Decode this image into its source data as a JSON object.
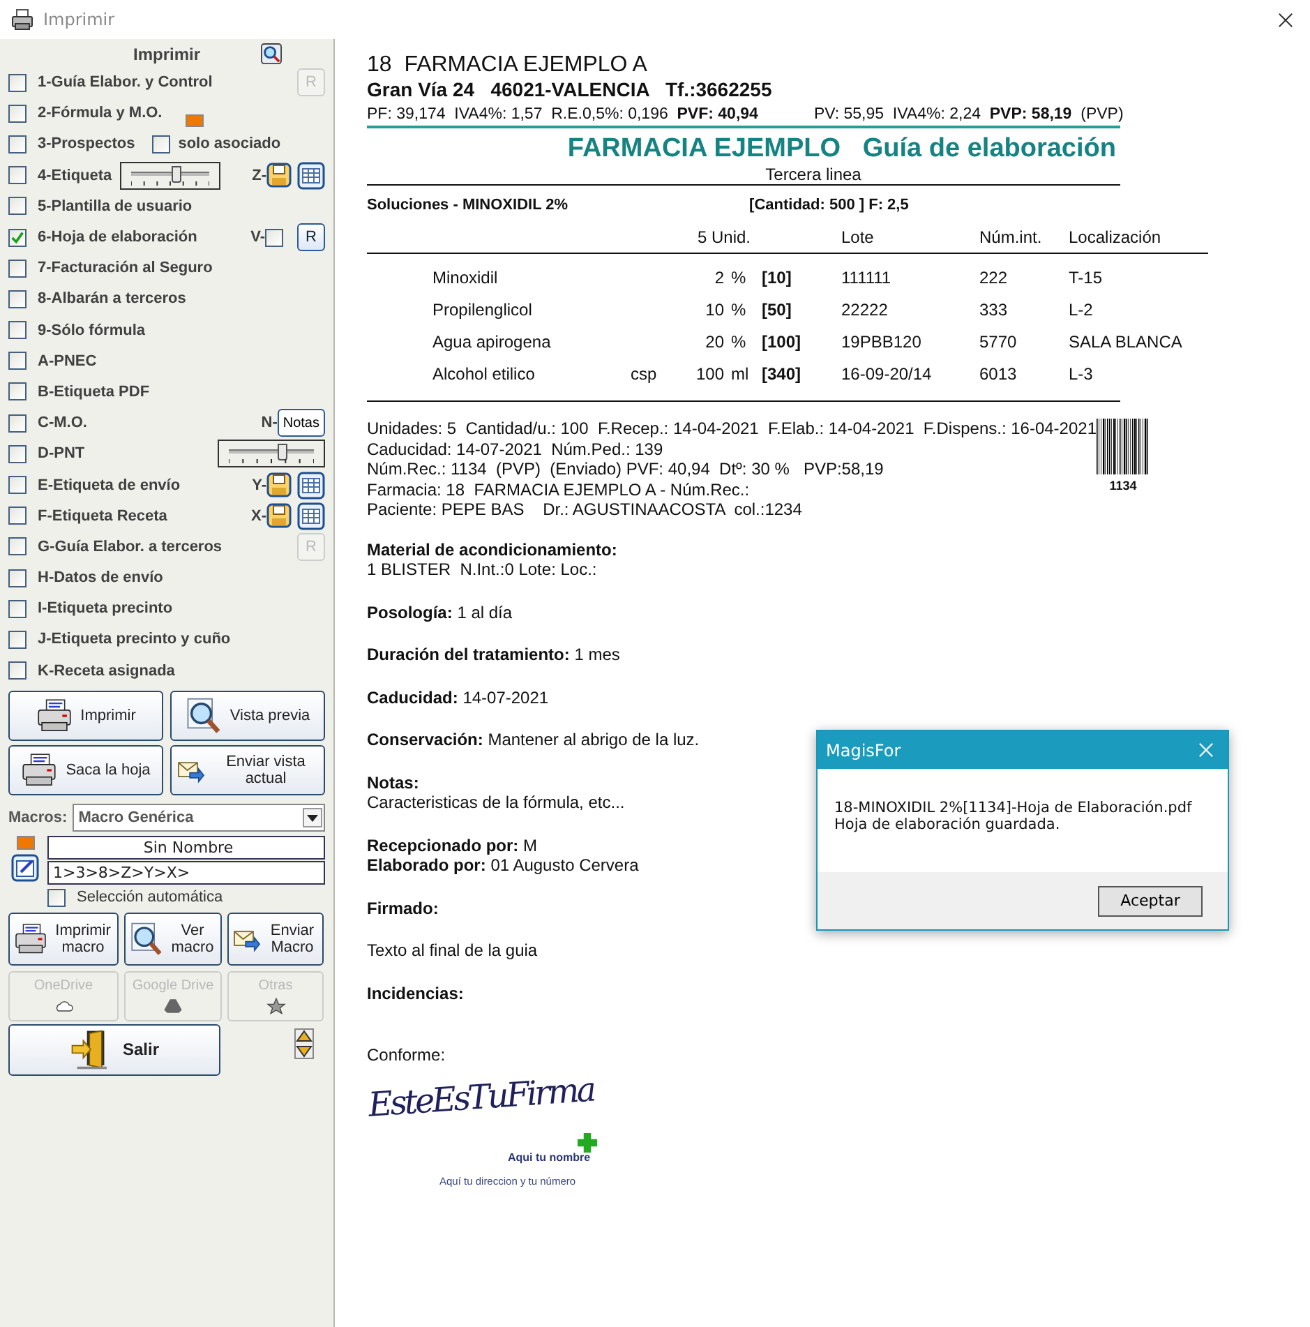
{
  "window": {
    "title": "Imprimir"
  },
  "print_panel": {
    "title": "Imprimir",
    "options": [
      {
        "label": "1-Guía Elabor. y Control",
        "checked": false,
        "kind": "r_button",
        "button": "R",
        "button_disabled": true
      },
      {
        "label": "2-Fórmula y M.O.",
        "checked": false,
        "kind": "marker"
      },
      {
        "label": "3-Prospectos",
        "checked": false,
        "kind": "sub_check",
        "sub_label": "solo asociado",
        "sub_checked": false
      },
      {
        "label": "4-Etiqueta",
        "checked": false,
        "kind": "slider_icons",
        "level": 0.55,
        "prefix": "Z-"
      },
      {
        "label": "5-Plantilla de usuario",
        "checked": false,
        "kind": "plain"
      },
      {
        "label": "6-Hoja de elaboración",
        "checked": true,
        "kind": "check_r",
        "prefix": "V-",
        "sub_checked": false,
        "button": "R",
        "button_disabled": false
      },
      {
        "label": "7-Facturación al Seguro",
        "checked": false,
        "kind": "plain"
      },
      {
        "label": "8-Albarán a terceros",
        "checked": false,
        "kind": "plain"
      },
      {
        "label": "9-Sólo fórmula",
        "checked": false,
        "kind": "plain"
      },
      {
        "label": "A-PNEC",
        "checked": false,
        "kind": "plain"
      },
      {
        "label": "B-Etiqueta PDF",
        "checked": false,
        "kind": "plain"
      },
      {
        "label": "C-M.O.",
        "checked": false,
        "kind": "notes",
        "prefix": "N-",
        "button": "Notas"
      },
      {
        "label": "D-PNT",
        "checked": false,
        "kind": "slider",
        "level": 0.6
      },
      {
        "label": "E-Etiqueta de envío",
        "checked": false,
        "kind": "icons",
        "prefix": "Y-"
      },
      {
        "label": "F-Etiqueta Receta",
        "checked": false,
        "kind": "icons",
        "prefix": "X-"
      },
      {
        "label": "G-Guía Elabor. a terceros",
        "checked": false,
        "kind": "r_button",
        "button": "R",
        "button_disabled": true
      },
      {
        "label": "H-Datos de envío",
        "checked": false,
        "kind": "plain"
      },
      {
        "label": "I-Etiqueta precinto",
        "checked": false,
        "kind": "plain"
      },
      {
        "label": "J-Etiqueta precinto y cuño",
        "checked": false,
        "kind": "plain"
      },
      {
        "label": "K-Receta asignada",
        "checked": false,
        "kind": "plain"
      }
    ]
  },
  "actions": [
    {
      "label": "Imprimir",
      "kind": "printer"
    },
    {
      "label": "Vista previa",
      "kind": "preview"
    },
    {
      "label": "Saca la hoja",
      "kind": "printer"
    },
    {
      "label": "Enviar vista actual",
      "kind": "send"
    }
  ],
  "macros": {
    "label": "Macros:",
    "value": "Macro Genérica",
    "name": "Sin Nombre",
    "sequence": "1>3>8>Z>Y>X>",
    "auto_select": {
      "label": "Selección automática",
      "checked": false
    }
  },
  "macro_buttons": [
    {
      "label": "Imprimir macro",
      "kind": "printer"
    },
    {
      "label": "Ver macro",
      "kind": "preview"
    },
    {
      "label": "Enviar Macro",
      "kind": "send"
    }
  ],
  "cloud_buttons": [
    {
      "label": "OneDrive",
      "kind": "cloud",
      "disabled": true
    },
    {
      "label": "Google Drive",
      "kind": "drive",
      "disabled": true
    },
    {
      "label": "Otras",
      "kind": "star",
      "disabled": true
    }
  ],
  "exit_button": {
    "label": "Salir"
  },
  "document": {
    "pharmacy": "18  FARMACIA EJEMPLO A",
    "address": "Gran Vía 24   46021-VALENCIA   Tf.:3662255",
    "prices": [
      "PF: 39,174  IVA4%: 1,57  R.E.0,5%: 0,196  **PVF: 40,94**",
      "PV: 55,95  IVA4%: 2,24  **PVP: 58,19**  (PVP)"
    ],
    "title": "FARMACIA EJEMPLO   Guía de elaboración",
    "subtitle": "Tercera linea",
    "formula": "Soluciones - MINOXIDIL 2%",
    "quantity": "[Cantidad: 500 ] F: 2,5",
    "columns": [
      "5 Unid.",
      "Lote",
      "Núm.int.",
      "Localización"
    ],
    "rows": [
      {
        "name": "Minoxidil",
        "qty": "2",
        "unit": "%",
        "amount": "[10]",
        "lot": "111111",
        "int_no": "222",
        "location": "T-15"
      },
      {
        "name": "Propilenglicol",
        "qty": "10",
        "unit": "%",
        "amount": "[50]",
        "lot": "22222",
        "int_no": "333",
        "location": "L-2"
      },
      {
        "name": "Agua apirogena",
        "qty": "20",
        "unit": "%",
        "amount": "[100]",
        "lot": "19PBB120",
        "int_no": "5770",
        "location": "SALA BLANCA"
      },
      {
        "name": "Alcohol etilico",
        "csp": "csp",
        "qty": "100",
        "unit": "ml",
        "amount": "[340]",
        "lot": "16-09-20/14",
        "int_no": "6013",
        "location": "L-3"
      }
    ],
    "info": [
      "Unidades: 5  Cantidad/u.: 100  F.Recep.: 14-04-2021  F.Elab.: 14-04-2021  F.Dispens.: 16-04-2021",
      "Caducidad: 14-07-2021  Núm.Ped.: 139",
      "Núm.Rec.: 1134  (PVP)  (Enviado) PVF: 40,94  Dtº: 30 %   PVP:58,19",
      "Farmacia: 18  FARMACIA EJEMPLO A - Núm.Rec.:",
      "Paciente: PEPE BAS    Dr.: AGUSTINAACOSTA  col.:1234"
    ],
    "barcode": "1134",
    "sections": [
      [
        {
          "label": "Material de acondicionamiento:"
        },
        {
          "value": "1 BLISTER  N.Int.:0 Lote: Loc.:"
        }
      ],
      [
        {
          "label": "Posología:",
          "value": "1 al día"
        }
      ],
      [
        {
          "label": "Duración del tratamiento:",
          "value": "1 mes"
        }
      ],
      [
        {
          "label": "Caducidad:",
          "value": "14-07-2021"
        }
      ],
      [
        {
          "label": "Conservación:",
          "value": "Mantener al abrigo de la luz."
        }
      ],
      [
        {
          "label": "Notas:"
        },
        {
          "value": "Caracteristicas de la fórmula, etc..."
        }
      ],
      [
        {
          "label": "Recepcionado por:",
          "value": "M"
        },
        {
          "label": "Elaborado por:",
          "value": "01 Augusto Cervera"
        }
      ],
      [
        {
          "label": "Firmado:"
        }
      ],
      [
        {
          "value": "Texto al final de la guia"
        }
      ],
      [
        {
          "label": "Incidencias:"
        }
      ],
      [
        {
          "value": "Conforme:"
        }
      ]
    ],
    "signature": {
      "handwriting": "EsteEsTuFirma",
      "name": "Aqui tu nombre",
      "address": "Aquí tu direccion y tu número"
    }
  },
  "dialog": {
    "title": "MagisFor",
    "message": [
      "18-MINOXIDIL 2%[1134]-Hoja de Elaboración.pdf",
      "Hoja de elaboración guardada."
    ],
    "button": "Aceptar"
  }
}
